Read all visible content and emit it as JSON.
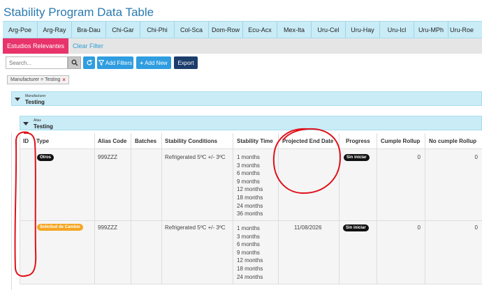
{
  "page_title": "Stability Program Data Table",
  "country_tabs": [
    "Arg-Poe",
    "Arg-Ray",
    "Bra-Dau",
    "Chi-Gar",
    "Chi-Phi",
    "Col-Sca",
    "Dom-Row",
    "Ecu-Acx",
    "Mex-Ita",
    "Uru-Cel",
    "Uru-Hay",
    "Uru-Icl",
    "Uru-MPh",
    "Uru-Roe"
  ],
  "subtabs": {
    "active": "Estudios Relevantes",
    "clear_filter": "Clear Filter"
  },
  "toolbar": {
    "search_placeholder": "Search...",
    "add_filters": "Add Filters",
    "add_new": "Add New",
    "export": "Export"
  },
  "active_filter": {
    "label": "Manufacturer = Testing",
    "remove": "×"
  },
  "groups": {
    "manufacturer": {
      "caption": "Manufacturer",
      "value": "Testing"
    },
    "alias": {
      "caption": "Alias",
      "value": "Testing"
    }
  },
  "columns": [
    "ID",
    "Type",
    "Alias Code",
    "Batches",
    "Stability Conditions",
    "Stability Time",
    "Projected End Date",
    "Progress",
    "Cumple Rollup",
    "No cumple Rollup"
  ],
  "rows": [
    {
      "id": "",
      "type": "Otros",
      "type_color": "#111111",
      "alias_code": "999ZZZ",
      "batches": "",
      "conditions": "Refrigerated 5ºC +/- 3ºC",
      "times": "1 months\n3 months\n6 months\n9 months\n12 months\n18 months\n24 months\n36 months",
      "end_date": "",
      "progress": "Sin iniciar",
      "cumple": "0",
      "no_cumple": "0"
    },
    {
      "id": "",
      "type": "Solicitud de Cambio",
      "type_color": "#f5a623",
      "alias_code": "999ZZZ",
      "batches": "",
      "conditions": "Refrigerated 5ºC +/- 3ºC",
      "times": "1 months\n3 months\n6 months\n9 months\n12 months\n18 months\n24 months",
      "end_date": "11/08/2026",
      "progress": "Sin iniciar",
      "cumple": "0",
      "no_cumple": "0"
    }
  ],
  "colors": {
    "accent_blue": "#2f9de0",
    "header_blue": "#c9ecf7",
    "pink": "#e8336b",
    "navy": "#1b3d6b",
    "annotation_red": "#e0111a"
  }
}
